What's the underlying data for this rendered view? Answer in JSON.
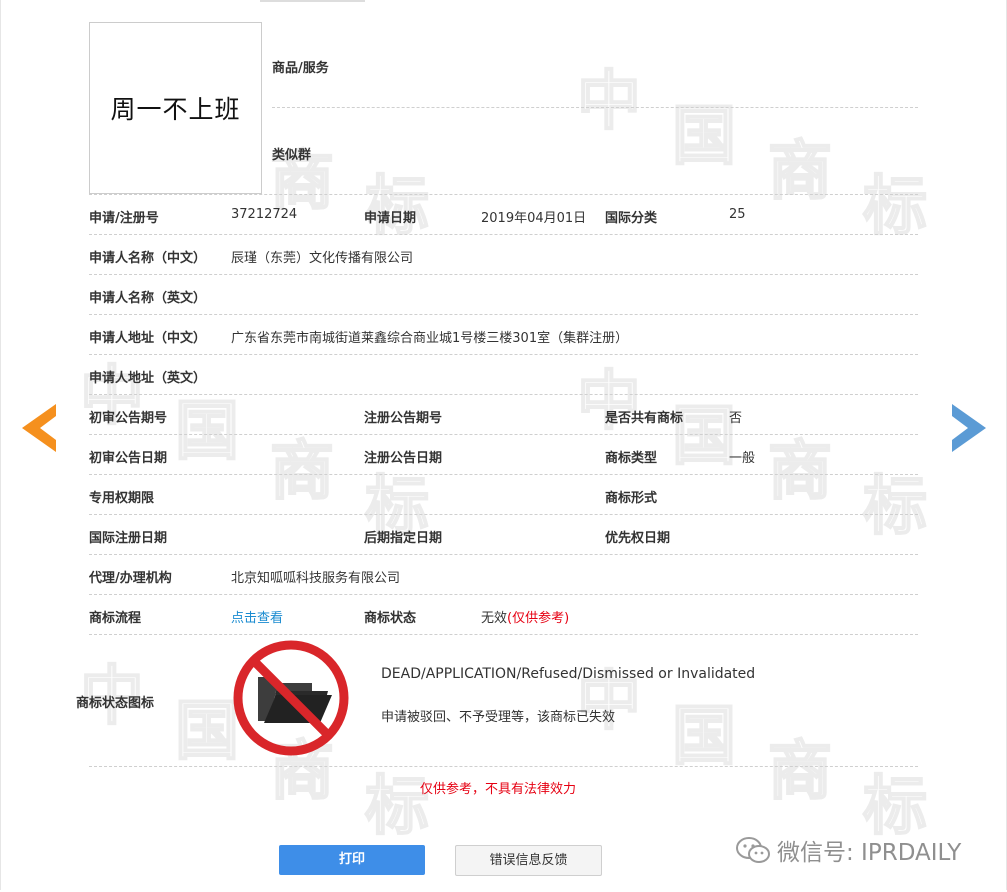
{
  "logo": {
    "text": "周一不上班"
  },
  "watermark": {
    "chars": [
      "中",
      "国",
      "商",
      "标"
    ]
  },
  "top": {
    "goods_label": "商品/服务",
    "similar_label": "类似群"
  },
  "row1": {
    "reg_label": "申请/注册号",
    "reg_value": "37212724",
    "date_label": "申请日期",
    "date_value": "2019年04月01日",
    "class_label": "国际分类",
    "class_value": "25"
  },
  "applicant": {
    "name_cn_label": "申请人名称（中文）",
    "name_cn_value": "辰瑾（东莞）文化传播有限公司",
    "name_en_label": "申请人名称（英文）",
    "addr_cn_label": "申请人地址（中文）",
    "addr_cn_value": "广东省东莞市南城街道莱鑫综合商业城1号楼三楼301室（集群注册）",
    "addr_en_label": "申请人地址（英文）"
  },
  "pub": {
    "prelim_no_label": "初审公告期号",
    "reg_no_label": "注册公告期号",
    "shared_label": "是否共有商标",
    "shared_value": "否",
    "prelim_date_label": "初审公告日期",
    "reg_date_label": "注册公告日期",
    "type_label": "商标类型",
    "type_value": "一般",
    "term_label": "专用权期限",
    "form_label": "商标形式",
    "intl_date_label": "国际注册日期",
    "later_date_label": "后期指定日期",
    "priority_label": "优先权日期"
  },
  "agent": {
    "label": "代理/办理机构",
    "value": "北京知呱呱科技服务有限公司"
  },
  "flow": {
    "label": "商标流程",
    "link": "点击查看",
    "status_label": "商标状态",
    "status_value": "无效",
    "status_note": "(仅供参考)"
  },
  "status_icon": {
    "label": "商标状态图标",
    "icon": "folder-prohibited-icon",
    "en_text": "DEAD/APPLICATION/Refused/Dismissed or Invalidated",
    "cn_text": "申请被驳回、不予受理等，该商标已失效"
  },
  "disclaimer": "仅供参考，不具有法律效力",
  "buttons": {
    "print": "打印",
    "feedback": "错误信息反馈"
  },
  "wechat": {
    "text": "微信号: IPRDAILY",
    "icon": "wechat-icon"
  },
  "nav": {
    "prev_icon": "left-arrow-icon",
    "next_icon": "right-arrow-icon"
  },
  "colors": {
    "accent_blue": "#3e8ee8",
    "link": "#1a8bd0",
    "warning": "#e60012",
    "prev_arrow": "#f5901e",
    "next_arrow": "#5b9bd5"
  }
}
